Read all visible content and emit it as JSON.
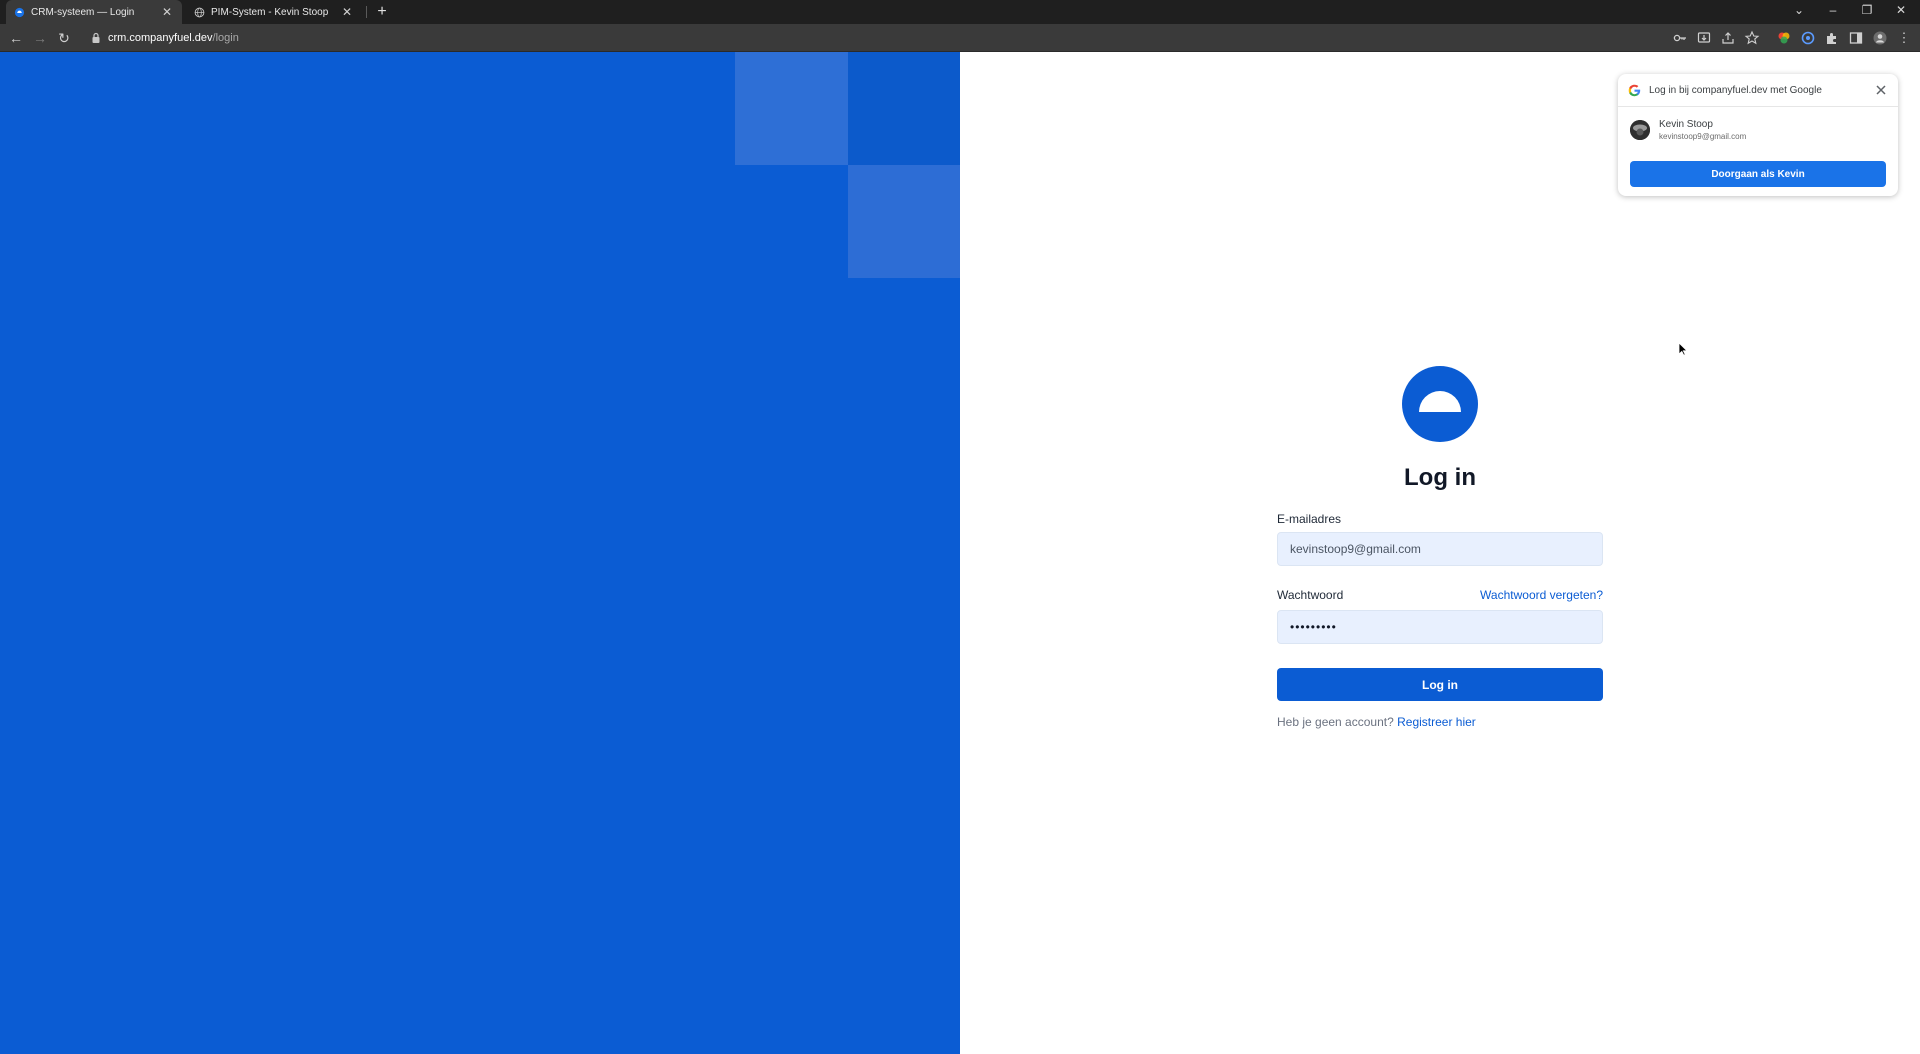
{
  "browser": {
    "tabs": [
      {
        "title": "CRM-systeem — Login",
        "active": true
      },
      {
        "title": "PIM-System - Kevin Stoop",
        "active": false
      }
    ],
    "url_host": "crm.companyfuel.dev",
    "url_path": "/login"
  },
  "login": {
    "title": "Log in",
    "email_label": "E-mailadres",
    "email_value": "kevinstoop9@gmail.com",
    "password_label": "Wachtwoord",
    "password_value": "•••••••••",
    "forgot_link": "Wachtwoord vergeten?",
    "submit_label": "Log in",
    "no_account_text": "Heb je geen account?",
    "register_link": "Registreer hier"
  },
  "google_popup": {
    "title": "Log in bij companyfuel.dev met Google",
    "account_name": "Kevin Stoop",
    "account_email": "kevinstoop9@gmail.com",
    "continue_label": "Doorgaan als Kevin"
  },
  "colors": {
    "brand_blue": "#0b5cd3",
    "google_blue": "#1a73e8"
  }
}
